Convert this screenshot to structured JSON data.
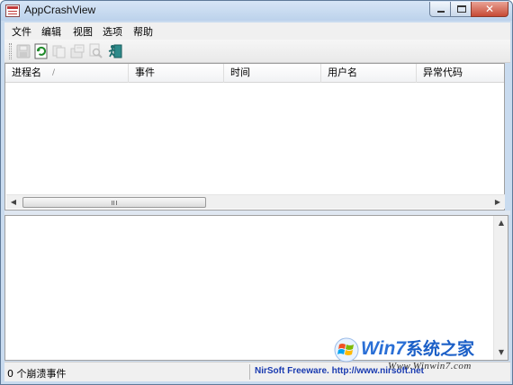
{
  "window": {
    "title": "AppCrashView",
    "icon": "report-window-icon",
    "controls": {
      "minimize": "minimize-icon",
      "maximize": "maximize-icon",
      "close": "close-icon",
      "close_glyph": "✕"
    }
  },
  "menu": {
    "items": [
      {
        "label": "文件"
      },
      {
        "label": "编辑"
      },
      {
        "label": "视图"
      },
      {
        "label": "选项"
      },
      {
        "label": "帮助"
      }
    ]
  },
  "toolbar": {
    "buttons": [
      {
        "icon": "save-icon",
        "enabled": false
      },
      {
        "icon": "refresh-icon",
        "enabled": true
      },
      {
        "icon": "copy-icon",
        "enabled": false
      },
      {
        "icon": "properties-icon",
        "enabled": false
      },
      {
        "icon": "find-icon",
        "enabled": false
      },
      {
        "icon": "exit-icon",
        "enabled": true
      }
    ]
  },
  "list": {
    "columns": [
      {
        "label": "进程名"
      },
      {
        "label": "事件"
      },
      {
        "label": "时间"
      },
      {
        "label": "用户名"
      },
      {
        "label": "异常代码"
      }
    ],
    "sort_indicator": "/",
    "rows": []
  },
  "scrollbar": {
    "left_arrow": "◀",
    "right_arrow": "▶",
    "up_arrow": "▲",
    "down_arrow": "▼"
  },
  "status": {
    "count_text": "0 个崩溃事件",
    "link_text": "NirSoft Freeware.  http://www.nirsoft.net"
  },
  "watermark": {
    "title_latin": "Win7",
    "title_cjk": "系统之家",
    "url": "Www.Winwin7.com"
  },
  "colors": {
    "accent_link": "#1a3bb0",
    "watermark_blue": "#2a6fd6",
    "close_button": "#c74a35"
  }
}
